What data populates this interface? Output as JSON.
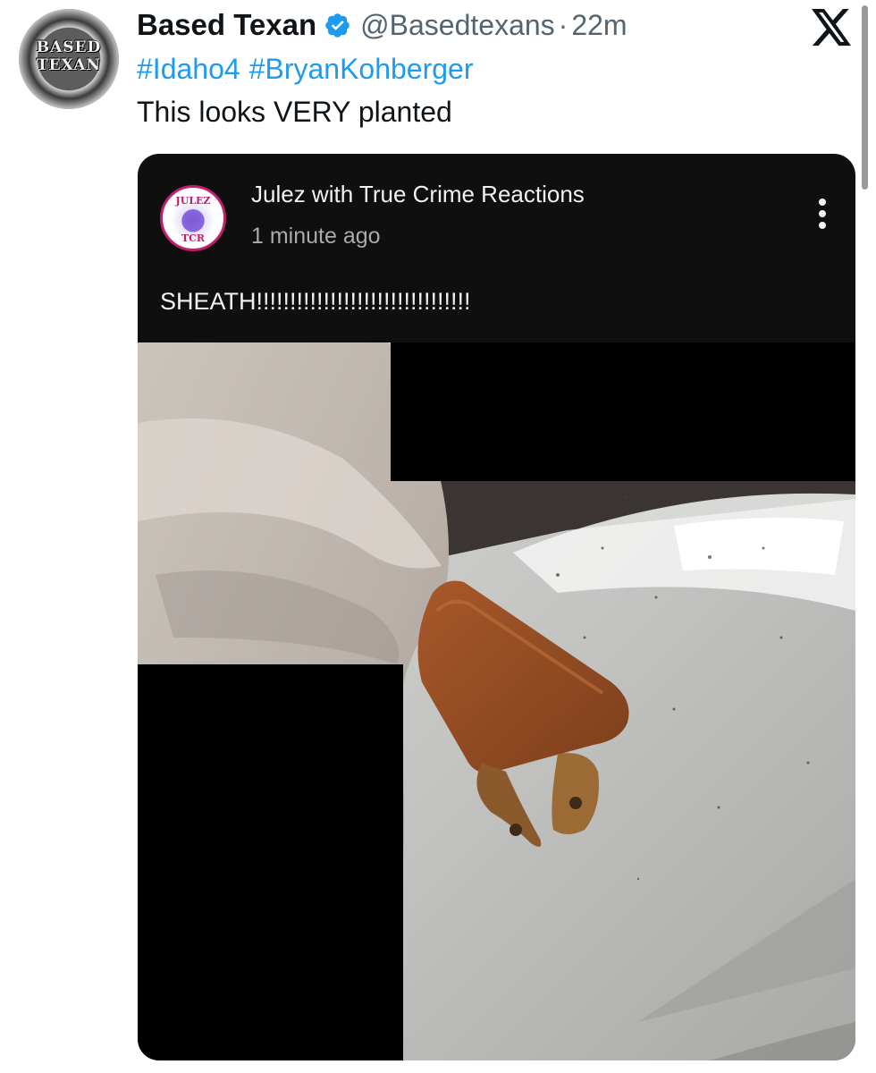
{
  "tweet": {
    "author": {
      "display_name": "Based Texan",
      "handle": "@Basedtexans",
      "avatar_text": [
        "BASED",
        "TEXAN"
      ],
      "verified": true
    },
    "separator": "·",
    "time": "22m",
    "hashtags": [
      "#Idaho4",
      "#BryanKohberger"
    ],
    "text": "This looks VERY planted",
    "platform_logo": "x-logo-icon"
  },
  "embedded_post": {
    "channel_name": "Julez with True Crime Reactions",
    "posted_time": "1 minute ago",
    "avatar_text": [
      "JULEZ",
      "TCR"
    ],
    "comment": "SHEATH!!!!!!!!!!!!!!!!!!!!!!!!!!!!!!!!",
    "menu_icon": "more-vertical-icon",
    "image_subject": "brown leather knife sheath on a white bed"
  },
  "colors": {
    "link": "#1d9bf0",
    "secondary_text": "#536471",
    "card_bg": "#0f0f0f",
    "verified": "#1d9bf0"
  }
}
